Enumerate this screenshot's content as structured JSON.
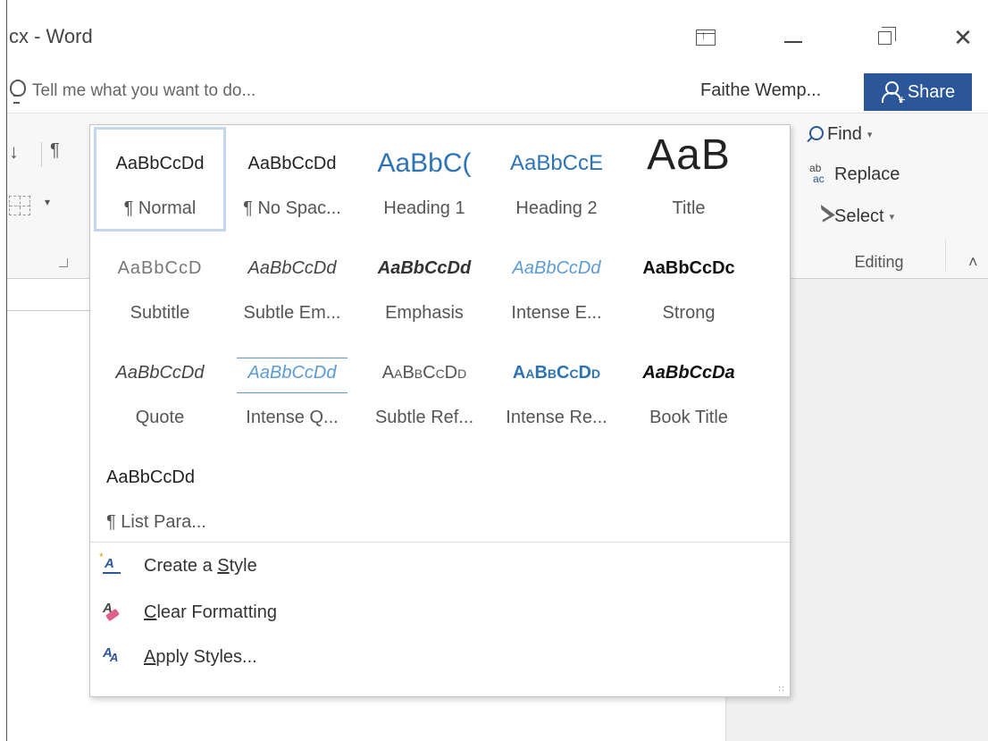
{
  "window": {
    "title": "cx - Word",
    "close_glyph": "✕"
  },
  "tellme": {
    "placeholder": "Tell me what you want to do...",
    "user": "Faithe Wemp...",
    "share_label": "Share"
  },
  "ribbon": {
    "sort_glyph": "↓",
    "pilcrow_glyph": "¶",
    "dropdown_glyph": "▾",
    "editing": {
      "find": "Find",
      "replace": "Replace",
      "select": "Select",
      "group_label": "Editing",
      "collapse_glyph": "˄"
    }
  },
  "styles": [
    {
      "preview": "AaBbCcDd",
      "label": "¶ Normal",
      "selected": true
    },
    {
      "preview": "AaBbCcDd",
      "label": "¶ No Spac..."
    },
    {
      "preview": "AaBbC(",
      "label": "Heading 1"
    },
    {
      "preview": "AaBbCcE",
      "label": "Heading 2"
    },
    {
      "preview": "AaB",
      "label": "Title"
    },
    {
      "preview": "AaBbCcD",
      "label": "Subtitle"
    },
    {
      "preview": "AaBbCcDd",
      "label": "Subtle Em..."
    },
    {
      "preview": "AaBbCcDd",
      "label": "Emphasis"
    },
    {
      "preview": "AaBbCcDd",
      "label": "Intense E..."
    },
    {
      "preview": "AaBbCcDc",
      "label": "Strong"
    },
    {
      "preview": "AaBbCcDd",
      "label": "Quote"
    },
    {
      "preview": "AaBbCcDd",
      "label": "Intense Q..."
    },
    {
      "preview": "AaBbCcDd",
      "label": "Subtle Ref..."
    },
    {
      "preview": "AaBbCcDd",
      "label": "Intense Re..."
    },
    {
      "preview": "AaBbCcDa",
      "label": "Book Title"
    },
    {
      "preview": "AaBbCcDd",
      "label": "¶ List Para..."
    }
  ],
  "commands": {
    "create": {
      "pre": "Create a ",
      "accel": "S",
      "post": "tyle"
    },
    "clear": {
      "pre": "",
      "accel": "C",
      "post": "lear Formatting"
    },
    "apply": {
      "pre": "",
      "accel": "A",
      "post": "pply Styles..."
    }
  },
  "colors": {
    "accent": "#2b579a",
    "heading": "#2e74b5",
    "intense": "#5b9bd5"
  }
}
